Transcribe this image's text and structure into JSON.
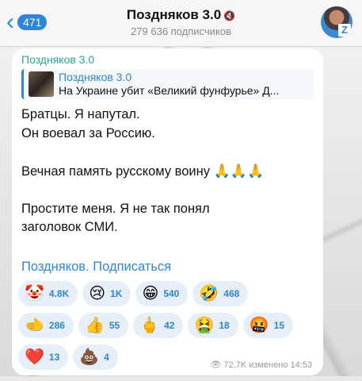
{
  "header": {
    "back_count": "471",
    "title": "Поздняков 3.0",
    "muted_glyph": "🔇",
    "subtitle": "279 636 подписчиков",
    "avatar_icon": "channel-avatar"
  },
  "post": {
    "author": "Поздняков 3.0",
    "reply": {
      "name": "Поздняков 3.0",
      "text": "На Украине убит «Великий фунфурье» Д..."
    },
    "lines": [
      "Братцы. Я напутал.",
      "Он воевал за Россию."
    ],
    "line3": "Вечная память русскому воину",
    "pray_emoji": "🙏🙏🙏",
    "line4": "Простите меня. Я не так понял",
    "line5": "заголовок СМИ.",
    "signature_name": "Поздняков.",
    "signature_subscribe": "Подписаться",
    "reactions_row1": [
      {
        "emoji": "🤡",
        "count": "4.8K"
      },
      {
        "emoji": "😢",
        "count": "1K"
      },
      {
        "emoji": "😁",
        "count": "540"
      },
      {
        "emoji": "🤣",
        "count": "468"
      }
    ],
    "reactions_row2": [
      {
        "emoji": "🫲",
        "count": "286"
      },
      {
        "emoji": "👍",
        "count": "55"
      },
      {
        "emoji": "🖕",
        "count": "42"
      },
      {
        "emoji": "🤮",
        "count": "18"
      },
      {
        "emoji": "🤬",
        "count": "15"
      }
    ],
    "reactions_row3": [
      {
        "emoji": "❤️",
        "count": "13"
      },
      {
        "emoji": "💩",
        "count": "4"
      }
    ],
    "views": "72,7K",
    "edited_time": "изменено 14:53"
  },
  "colors": {
    "accent": "#2f86d8",
    "author": "#2aa59b",
    "reaction_bg": "#e6eff8"
  }
}
